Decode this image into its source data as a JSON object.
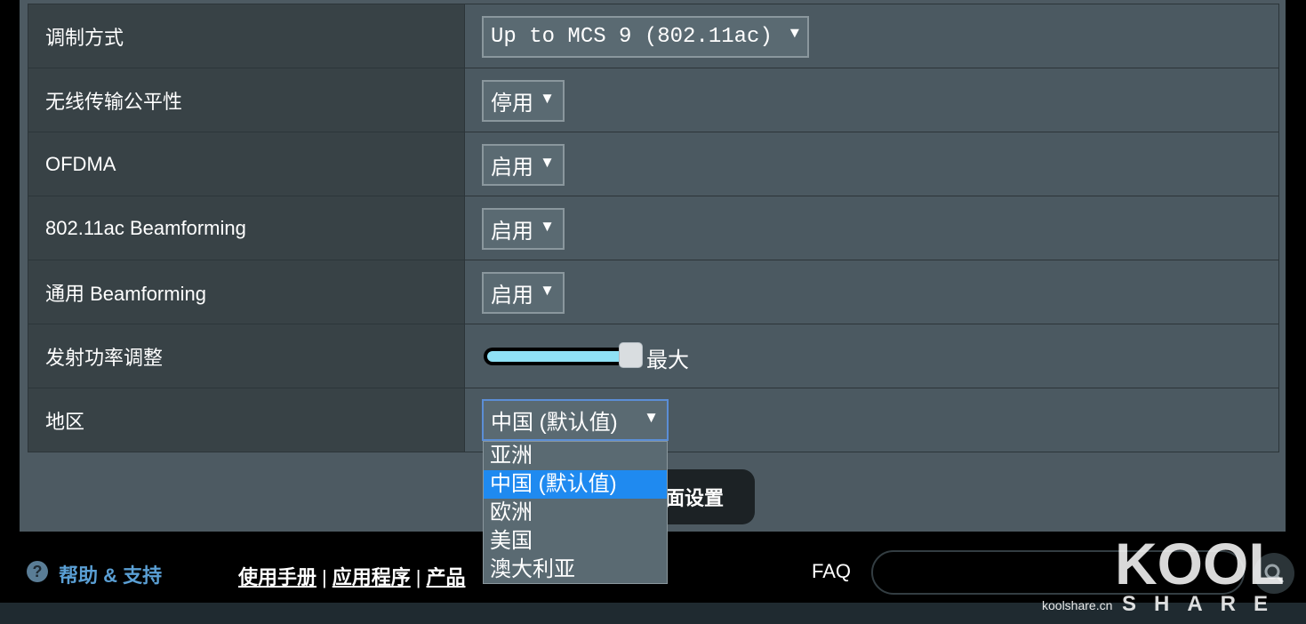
{
  "settings": {
    "rows": [
      {
        "label": "调制方式",
        "control": "select",
        "value": "Up to MCS 9 (802.11ac)"
      },
      {
        "label": "无线传输公平性",
        "control": "select",
        "value": "停用"
      },
      {
        "label": "OFDMA",
        "control": "select",
        "value": "启用"
      },
      {
        "label": "802.11ac Beamforming",
        "control": "select",
        "value": "启用"
      },
      {
        "label": "通用 Beamforming",
        "control": "select",
        "value": "启用"
      },
      {
        "label": "发射功率调整",
        "control": "slider",
        "value_label": "最大",
        "level": 1.0
      },
      {
        "label": "地区",
        "control": "select",
        "value": "中国 (默认值)"
      }
    ],
    "arrow_glyph": "▼"
  },
  "region_dropdown": {
    "options": [
      "亚洲",
      "中国 (默认值)",
      "欧洲",
      "美国",
      "澳大利亚"
    ],
    "selected_index": 1
  },
  "apply_button": {
    "label": "面设置"
  },
  "footer": {
    "help_icon": "question-circle-icon",
    "help_label": "帮助 & 支持",
    "links": [
      "使用手册",
      "应用程序",
      "产品"
    ],
    "separator": "|",
    "faq_label": "FAQ",
    "faq_value": ""
  },
  "watermark": {
    "brand_big": "KOOL",
    "brand_sub": "SHARE",
    "domain": "koolshare.cn"
  },
  "colors": {
    "accent": "#1f8af0",
    "slider_fill": "#8fe1f5",
    "help_text": "#5a9fd4"
  }
}
